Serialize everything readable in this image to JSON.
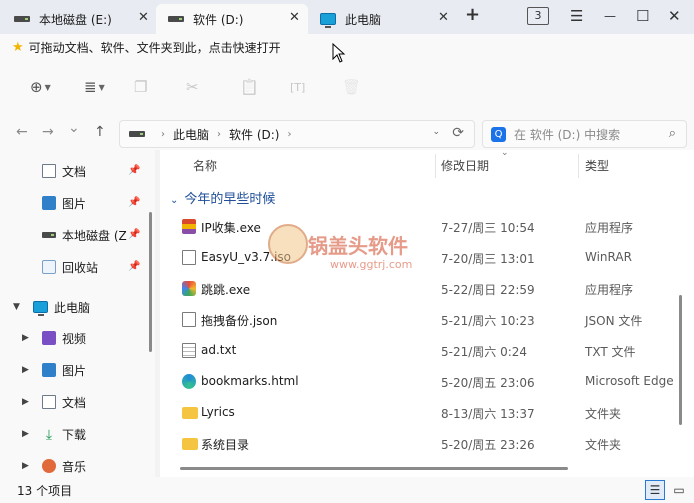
{
  "tabs": [
    {
      "label": "本地磁盘 (E:)",
      "icon": "drive-icon"
    },
    {
      "label": "软件 (D:)",
      "icon": "drive-icon"
    },
    {
      "label": "此电脑",
      "icon": "computer-icon"
    }
  ],
  "tab_controls": {
    "new_tab": "+",
    "tab_count": "3",
    "menu": "☰",
    "minimize": "—",
    "maximize": "☐",
    "close": "✕"
  },
  "hint": {
    "text": "可拖动文档、软件、文件夹到此，点击快速打开"
  },
  "toolbar": {
    "new": "⊕",
    "view": "≣",
    "copy": "❐",
    "cut": "✂",
    "paste": "📋",
    "rename": "[T]",
    "delete": "🗑"
  },
  "nav": {
    "back": "←",
    "forward": "→",
    "history": "⌄",
    "up": "↑"
  },
  "address": {
    "parts": [
      "此电脑",
      "软件 (D:)"
    ]
  },
  "search": {
    "badge": "Q",
    "placeholder": "在 软件 (D:) 中搜索"
  },
  "sidebar": {
    "quick": [
      {
        "label": "文档",
        "icon": "document-icon"
      },
      {
        "label": "图片",
        "icon": "picture-icon"
      },
      {
        "label": "本地磁盘 (Z",
        "icon": "drive-icon"
      },
      {
        "label": "回收站",
        "icon": "recycle-bin-icon"
      }
    ],
    "pc": {
      "label": "此电脑"
    },
    "pc_items": [
      {
        "label": "视频",
        "icon": "video-icon"
      },
      {
        "label": "图片",
        "icon": "picture-icon"
      },
      {
        "label": "文档",
        "icon": "document-icon"
      },
      {
        "label": "下载",
        "icon": "download-icon"
      },
      {
        "label": "音乐",
        "icon": "music-icon"
      }
    ]
  },
  "columns": {
    "name": "名称",
    "date": "修改日期",
    "type": "类型"
  },
  "group": {
    "label": "今年的早些时候"
  },
  "files": [
    {
      "name": "IP收集.exe",
      "date": "7-27/周三 10:54",
      "type": "应用程序",
      "icon": "exe-icon"
    },
    {
      "name": "EasyU_v3.7.iso",
      "date": "7-20/周三 13:01",
      "type": "WinRAR",
      "icon": "file-icon"
    },
    {
      "name": "跳跳.exe",
      "date": "5-22/周日 22:59",
      "type": "应用程序",
      "icon": "app-icon"
    },
    {
      "name": "拖拽备份.json",
      "date": "5-21/周六 10:23",
      "type": "JSON 文件",
      "icon": "file-icon"
    },
    {
      "name": "ad.txt",
      "date": "5-21/周六 0:24",
      "type": "TXT 文件",
      "icon": "text-file-icon"
    },
    {
      "name": "bookmarks.html",
      "date": "5-20/周五 23:06",
      "type": "Microsoft Edge",
      "icon": "edge-icon"
    },
    {
      "name": "Lyrics",
      "date": "8-13/周六 13:37",
      "type": "文件夹",
      "icon": "folder-icon"
    },
    {
      "name": "系统目录",
      "date": "5-20/周五 23:26",
      "type": "文件夹",
      "icon": "folder-icon"
    }
  ],
  "status": {
    "count": "13 个项目"
  },
  "watermark": {
    "brand": "锅盖头软件",
    "url": "www.ggtrj.com"
  }
}
